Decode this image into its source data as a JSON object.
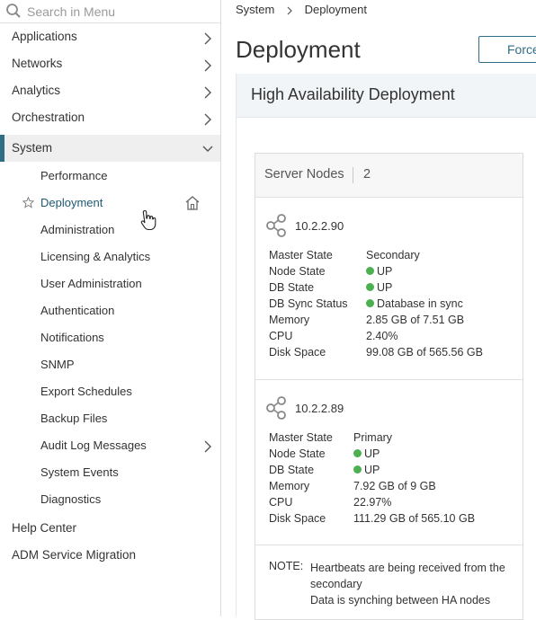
{
  "search": {
    "placeholder": "Search in Menu"
  },
  "nav": {
    "applications": "Applications",
    "networks": "Networks",
    "analytics": "Analytics",
    "orchestration": "Orchestration",
    "system": "System",
    "help_center": "Help Center",
    "adm_migration": "ADM Service Migration"
  },
  "system_sub": [
    "Performance",
    "Deployment",
    "Administration",
    "Licensing & Analytics",
    "User Administration",
    "Authentication",
    "Notifications",
    "SNMP",
    "Export Schedules",
    "Backup Files",
    "Audit Log Messages",
    "System Events",
    "Diagnostics"
  ],
  "breadcrumb": {
    "parent": "System",
    "current": "Deployment"
  },
  "page": {
    "title": "Deployment",
    "force_button": "Force"
  },
  "panel": {
    "title": "High Availability Deployment"
  },
  "server_nodes": {
    "label": "Server Nodes",
    "count": "2",
    "nodes": [
      {
        "ip": "10.2.2.90",
        "fields": [
          {
            "key": "Master State",
            "value": "Secondary",
            "dot": false
          },
          {
            "key": "Node State",
            "value": "UP",
            "dot": true
          },
          {
            "key": "DB State",
            "value": "UP",
            "dot": true
          },
          {
            "key": "DB Sync Status",
            "value": "Database in sync",
            "dot": true
          },
          {
            "key": "Memory",
            "value": "2.85 GB of 7.51 GB",
            "dot": false
          },
          {
            "key": "CPU",
            "value": "2.40%",
            "dot": false
          },
          {
            "key": "Disk Space",
            "value": "99.08 GB of 565.56 GB",
            "dot": false
          }
        ]
      },
      {
        "ip": "10.2.2.89",
        "fields": [
          {
            "key": "Master State",
            "value": "Primary",
            "dot": false
          },
          {
            "key": "Node State",
            "value": "UP",
            "dot": true
          },
          {
            "key": "DB State",
            "value": "UP",
            "dot": true
          },
          {
            "key": "Memory",
            "value": "7.92 GB of 9 GB",
            "dot": false
          },
          {
            "key": "CPU",
            "value": "22.97%",
            "dot": false
          },
          {
            "key": "Disk Space",
            "value": "111.29 GB of 565.10 GB",
            "dot": false
          }
        ]
      }
    ],
    "note_label": "NOTE:",
    "note_line1": "Heartbeats are being received from the secondary",
    "note_line2": "Data is synching between HA nodes"
  },
  "colors": {
    "accent": "#2f6e86",
    "status_up": "#4caf50"
  },
  "icons": [
    "search-icon",
    "chevron-right-icon",
    "chevron-down-icon",
    "star-icon",
    "home-icon",
    "pointer-cursor-icon",
    "share-nodes-icon"
  ]
}
